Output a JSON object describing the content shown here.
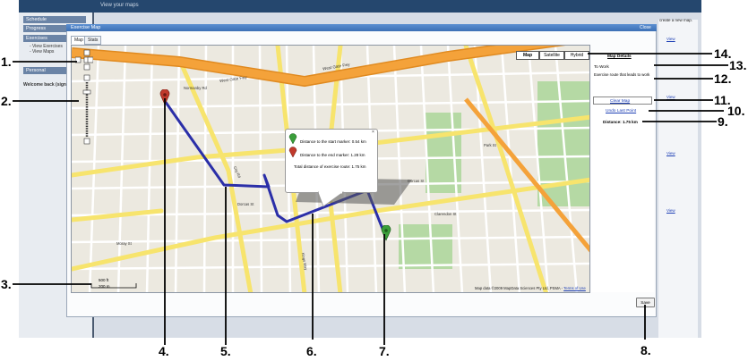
{
  "app": {
    "topbar_text": "View your maps",
    "sidebar": [
      {
        "label": "Schedule"
      },
      {
        "label": "Progress"
      },
      {
        "label": "Exercises"
      }
    ],
    "sidebar_subitems": [
      "- View Exercises",
      "- View Maps"
    ],
    "sidebar_personal": "Personal",
    "welcome_text": "Welcome back (sign",
    "right_note": "create a new map.",
    "right_links": [
      "View",
      "View",
      "View",
      "View"
    ]
  },
  "modal": {
    "title": "Exercise Map",
    "close_label": "Close",
    "tabs": [
      "Map",
      "Stats"
    ],
    "map_types": [
      "Map",
      "Satellite",
      "Hybrid"
    ],
    "details": {
      "title": "Map Details",
      "name": "To Work",
      "description": "Exercise route that leads to work",
      "clear_map": "Clear Map",
      "undo": "Undo Last Point",
      "distance": "Distance: 1.75 km"
    },
    "popup": {
      "start_line": "Distance to the start marker: 0.54 km",
      "end_line": "Distance to the end marker: 1.28 km",
      "total_line": "Total distance of exercise route: 1.75 km"
    },
    "scale": {
      "line1": "500 ft",
      "line2": "200 m"
    },
    "copyright": "Map data ©2009 MapData Sciences Pty Ltd, PSMA -",
    "copyright_link": "Terms of Use",
    "save_label": "Save",
    "streets": [
      "West Gate Fwy",
      "West Gate Fwy",
      "Normanby Rd",
      "City Rd",
      "Dorcas St",
      "Dorcas St",
      "Park St",
      "Clarendon St",
      "Moray St",
      "Kings Way"
    ]
  },
  "annotations": [
    "1.",
    "2.",
    "3.",
    "4.",
    "5.",
    "6.",
    "7.",
    "8.",
    "9.",
    "10.",
    "11.",
    "12.",
    "13.",
    "14."
  ],
  "colors": {
    "route": "#2b2fa8",
    "freeway": "#f4a23a",
    "major_road": "#f7e46d",
    "park": "#b5d9a4",
    "marker_start": "#3a9e3a",
    "marker_end": "#c0392b"
  }
}
